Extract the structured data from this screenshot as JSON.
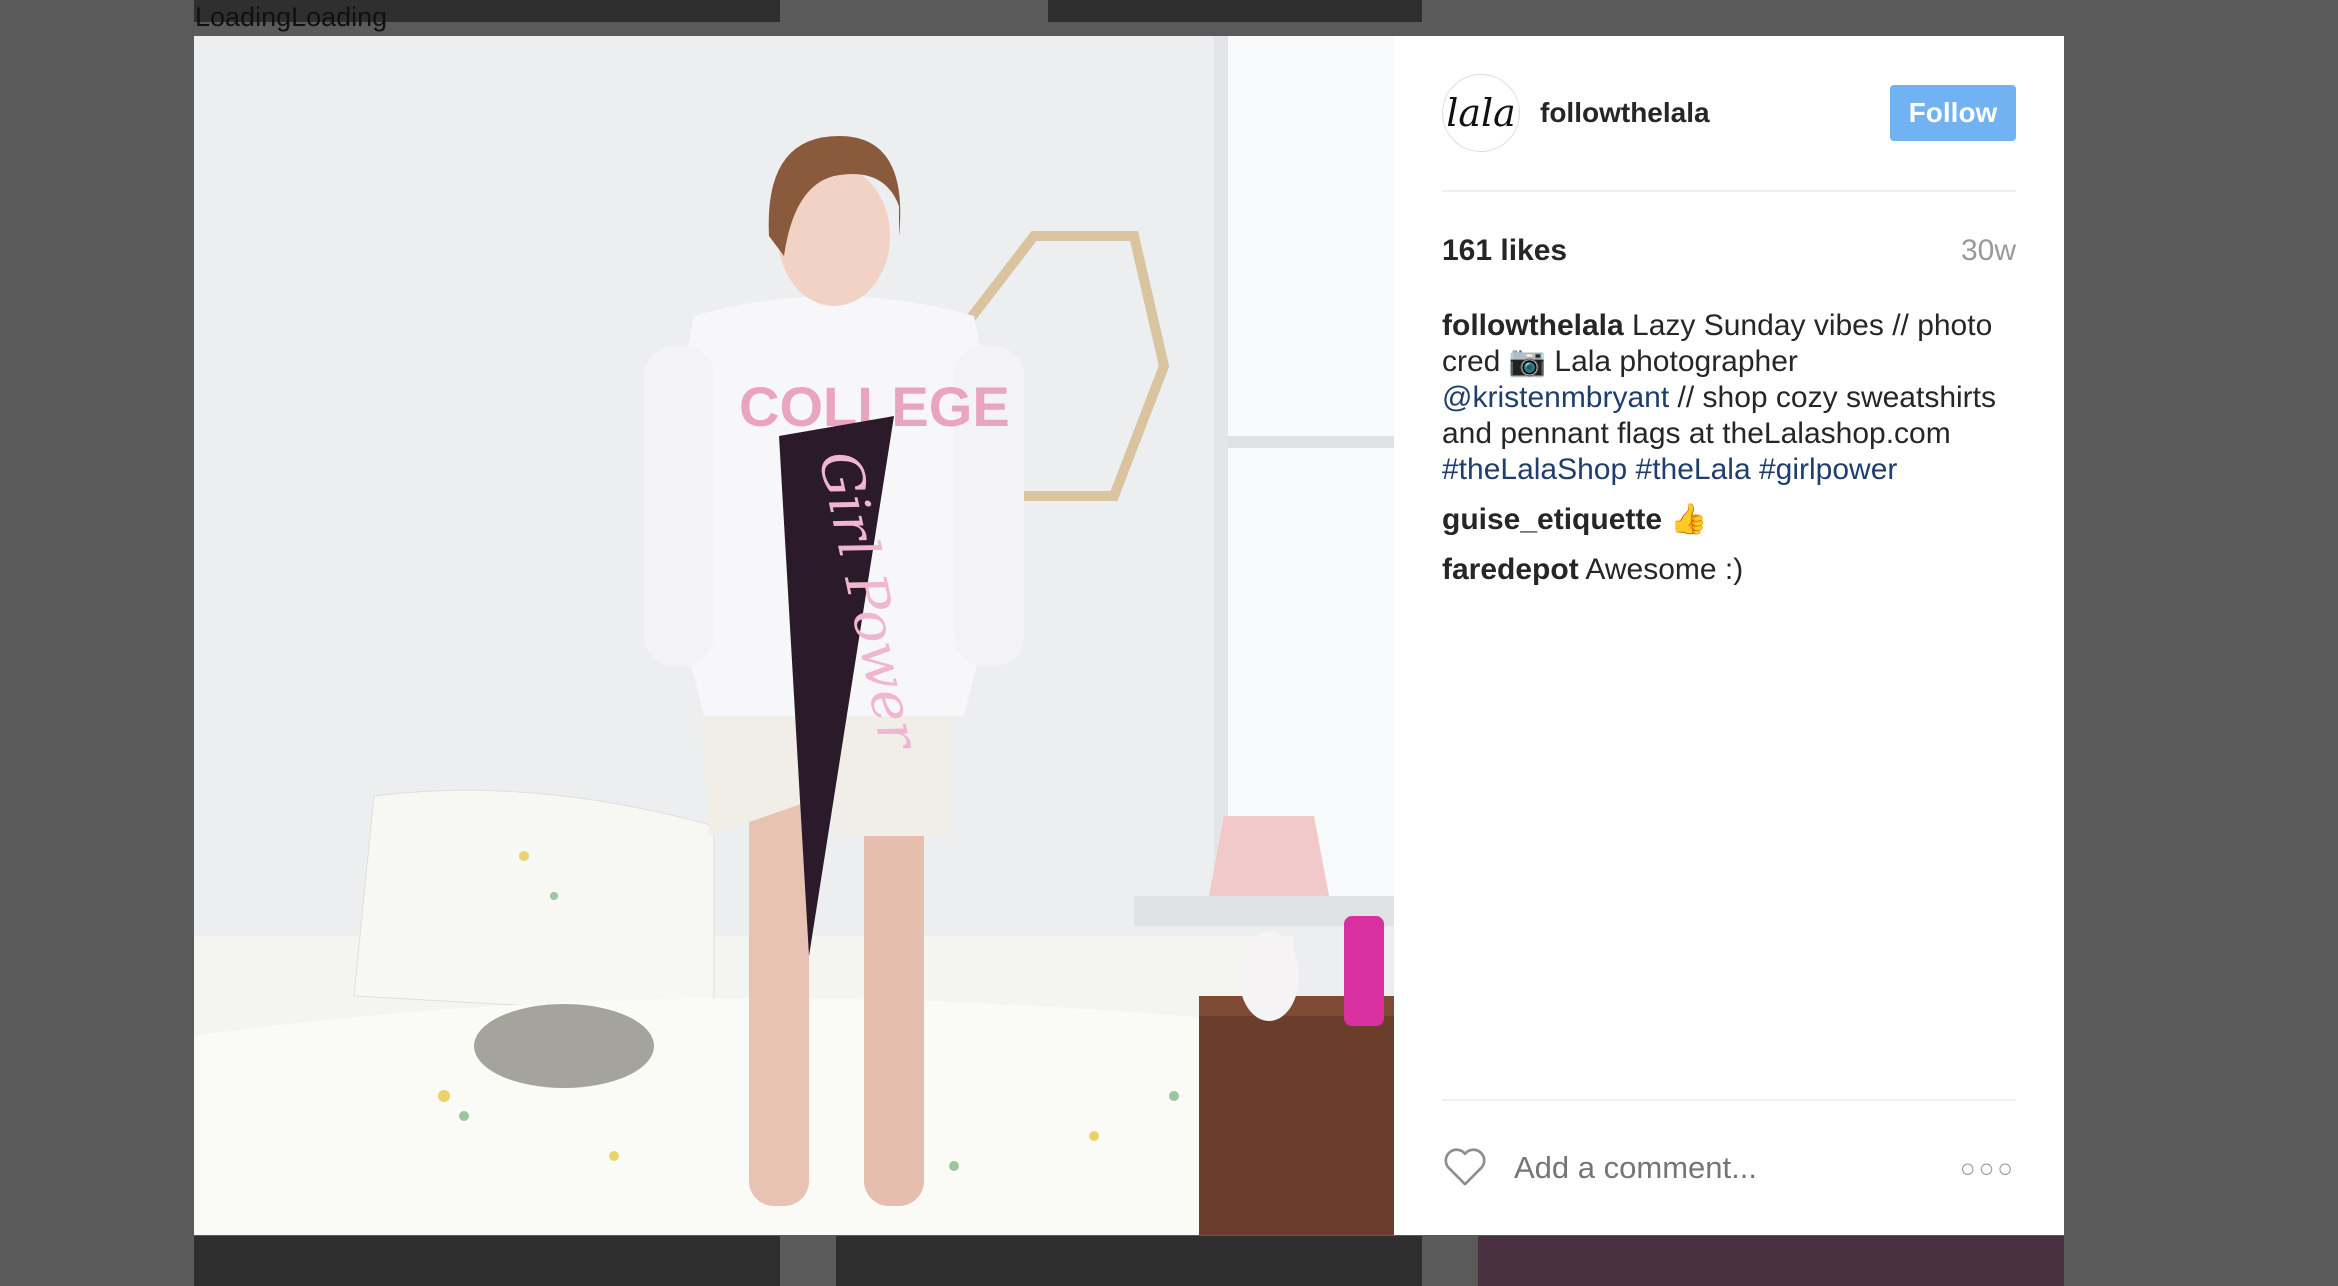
{
  "loading_text": "LoadingLoading",
  "post": {
    "username": "followthelala",
    "avatar_text": "lala",
    "follow_label": "Follow",
    "likes": "161 likes",
    "time": "30w",
    "caption": {
      "user": "followthelala",
      "text1": "Lazy Sunday vibes // photo cred 📷 Lala photographer",
      "mention": "@kristenmbryant",
      "text2": "// shop cozy sweatshirts and pennant flags at theLalashop.com",
      "tag1": "#theLalaShop",
      "tag2": "#theLala",
      "tag3": "#girlpower"
    },
    "comments": [
      {
        "user": "guise_etiquette",
        "text": "👍"
      },
      {
        "user": "faredepot",
        "text": "Awesome :)"
      }
    ],
    "comment_placeholder": "Add a comment...",
    "more_label": "○○○",
    "image_pennant_text": "Girl Power",
    "image_shirt_text": "COLLEGE"
  },
  "colors": {
    "follow_button": "#70b2f2",
    "link": "#1f3e6e",
    "overlay": "#5a5a5a"
  }
}
